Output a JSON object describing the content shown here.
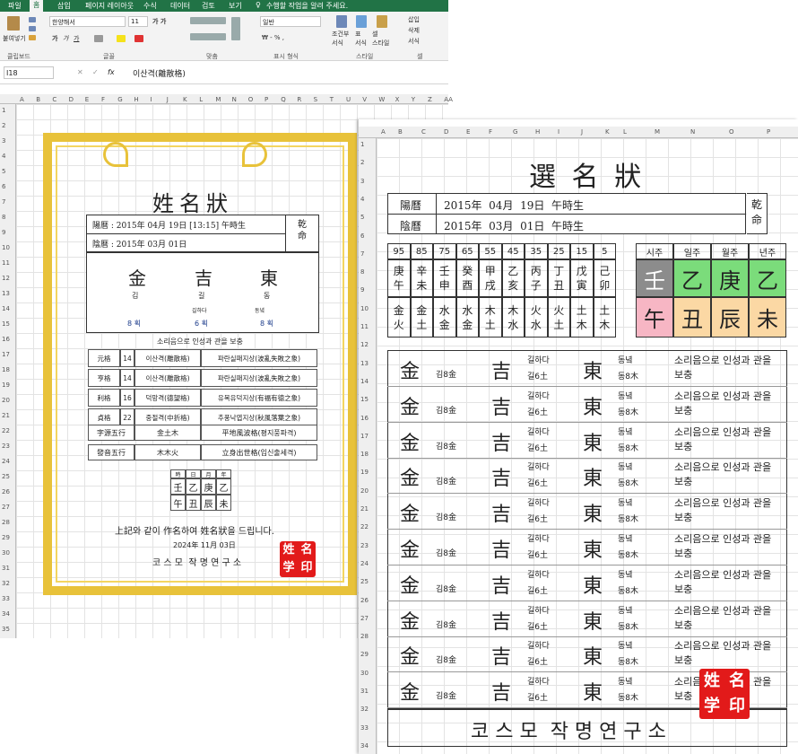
{
  "ribbon": {
    "tabs": [
      "파일",
      "홈",
      "삽입",
      "페이지 레이아웃",
      "수식",
      "데이터",
      "검토",
      "보기"
    ],
    "tell_me": "수행할 작업을 알려 주세요.",
    "paste": "붙여넣기",
    "font": "한양해서",
    "size": "11",
    "number_format": "일반",
    "cond_format": "조건부\n서식",
    "table_format": "표\n서식",
    "cell_style": "셀\n스타일",
    "insert": "삽입",
    "delete": "삭제",
    "format": "서식",
    "groups": [
      "클립보드",
      "글꼴",
      "맞춤",
      "표시 형식",
      "스타일",
      "셀"
    ]
  },
  "formula": {
    "cell": "I18",
    "fx": "fx",
    "content": "이산격(離散格)"
  },
  "cols_left": [
    "A",
    "B",
    "C",
    "D",
    "E",
    "F",
    "G",
    "H",
    "I",
    "J",
    "K",
    "L",
    "M",
    "N",
    "O",
    "P",
    "Q",
    "R",
    "S",
    "T",
    "U",
    "V",
    "W",
    "X",
    "Y",
    "Z",
    "AA"
  ],
  "rows_left": [
    "1",
    "2",
    "3",
    "4",
    "5",
    "6",
    "7",
    "8",
    "9",
    "10",
    "11",
    "12",
    "13",
    "14",
    "15",
    "16",
    "17",
    "18",
    "19",
    "20",
    "21",
    "22",
    "23",
    "24",
    "25",
    "26",
    "27",
    "28",
    "29",
    "30",
    "31",
    "32",
    "33",
    "34",
    "35"
  ],
  "cert": {
    "title": "姓名狀",
    "yang": "陽暦 : 2015年 04月 19日 [13:15] 午時生",
    "eum": "陰暦 : 2015年 03月 01日",
    "gun": "乾\n命",
    "hanja": [
      "金",
      "吉",
      "東"
    ],
    "hangul": [
      "김",
      "길",
      "동"
    ],
    "meaning": [
      "",
      "길하다",
      "동녘"
    ],
    "strokes": [
      "8 획",
      "6 획",
      "8 획"
    ],
    "note": "소리음으로 인성과 관을 보충",
    "grid": [
      [
        "元格",
        "14",
        "이산격(離散格)",
        "파란실패지상(波亂失敗之象)"
      ],
      [
        "亨格",
        "14",
        "이산격(離散格)",
        "파란실패지상(波亂失敗之象)"
      ],
      [
        "利格",
        "16",
        "덕망격(德望格)",
        "유복유덕지상(有福有德之象)"
      ],
      [
        "貞格",
        "22",
        "중절격(中折格)",
        "추풍낙엽지상(秋風落葉之象)"
      ]
    ],
    "jawon": [
      "字源五行",
      "金土木",
      "平地風波格(평지풍파격)"
    ],
    "balum": [
      "發音五行",
      "木木火",
      "立身出世格(입신출세격)"
    ],
    "pillar_head": [
      "時",
      "日",
      "月",
      "年"
    ],
    "pillar_top": [
      "壬",
      "乙",
      "庚",
      "乙"
    ],
    "pillar_bot": [
      "午",
      "丑",
      "辰",
      "未"
    ],
    "closing": "上記와 같이 作名하여 姓名狀을 드립니다.",
    "date": "2024年 11月 03日",
    "org": "코 스 모  작 명 연 구 소",
    "stamp": [
      "姓",
      "名",
      "学",
      "印"
    ]
  },
  "cols_right": [
    "A",
    "B",
    "C",
    "D",
    "E",
    "F",
    "G",
    "H",
    "I",
    "J",
    "K",
    "L",
    "M",
    "N",
    "O",
    "P"
  ],
  "rows_right": [
    "1",
    "2",
    "3",
    "4",
    "5",
    "6",
    "7",
    "8",
    "9",
    "10",
    "11",
    "12",
    "13",
    "14",
    "15",
    "16",
    "17",
    "18",
    "19",
    "20",
    "21",
    "22",
    "23",
    "24",
    "25",
    "26",
    "27",
    "28",
    "29",
    "30",
    "31",
    "32",
    "33",
    "34"
  ],
  "right": {
    "title": "選 名 狀",
    "yang_label": "陽曆",
    "yang": "2015年  04月  19日  午時生",
    "eum_label": "陰曆",
    "eum": "2015年  03月  01日  午時生",
    "gun": "乾\n命",
    "daeun_nums": [
      "95",
      "85",
      "75",
      "65",
      "55",
      "45",
      "35",
      "25",
      "15",
      "5"
    ],
    "daeun_top": [
      "庚\n午",
      "辛\n未",
      "壬\n申",
      "癸\n酉",
      "甲\n戌",
      "乙\n亥",
      "丙\n子",
      "丁\n丑",
      "戊\n寅",
      "己\n卯"
    ],
    "daeun_bot": [
      "金\n火",
      "金\n土",
      "水\n金",
      "水\n金",
      "木\n土",
      "木\n水",
      "火\n水",
      "火\n土",
      "土\n木",
      "土\n木"
    ],
    "pillar_head": [
      "시주",
      "일주",
      "월주",
      "년주"
    ],
    "pillar_top": [
      "壬",
      "乙",
      "庚",
      "乙"
    ],
    "pillar_bot": [
      "午",
      "丑",
      "辰",
      "未"
    ],
    "pillar_colors": {
      "gray": "#8c8c8c",
      "green": "#7bdc7b",
      "pink": "#f7b6c4",
      "peach": "#fbd8a4"
    },
    "row": {
      "h1": "金",
      "s1": "김8金",
      "h2": "吉",
      "m2": "길하다",
      "s2": "길6土",
      "h3": "東",
      "m3": "동녘",
      "s3": "동8木",
      "note": "소리음으로 인성과 관을\n보충"
    },
    "org": "코 스 모  작 명 연 구 소"
  }
}
